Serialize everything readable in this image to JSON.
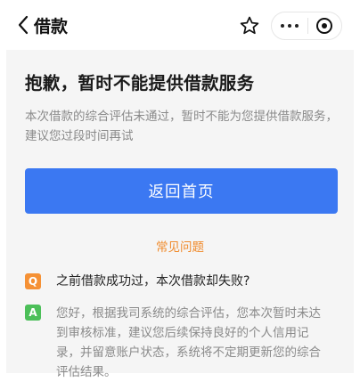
{
  "nav": {
    "back_icon": "chevron-left-icon",
    "title": "借款",
    "star_icon": "star-outline-icon",
    "more_icon": "more-dots-icon",
    "close_icon": "target-circle-icon"
  },
  "main": {
    "headline": "抱歉，暂时不能提供借款服务",
    "description": "本次借款的综合评估未通过，暂时不能为您提供借款服务，建议您过段时间再试",
    "primary_button": "返回首页",
    "faq_title": "常见问题",
    "faq": [
      {
        "q_badge": "Q",
        "question": "之前借款成功过，本次借款却失败?",
        "a_badge": "A",
        "answer": "您好，根据我司系统的综合评估，您本次暂时未达到审核标准，建议您后续保持良好的个人信用记录，并留意账户状态，系统将不定期更新您的综合评估结果。"
      }
    ]
  },
  "colors": {
    "primary": "#3b78f2",
    "faq_title": "#f08a2b",
    "q_badge": "#f59135",
    "a_badge": "#4cbf59",
    "content_bg": "#f5f5f5"
  }
}
